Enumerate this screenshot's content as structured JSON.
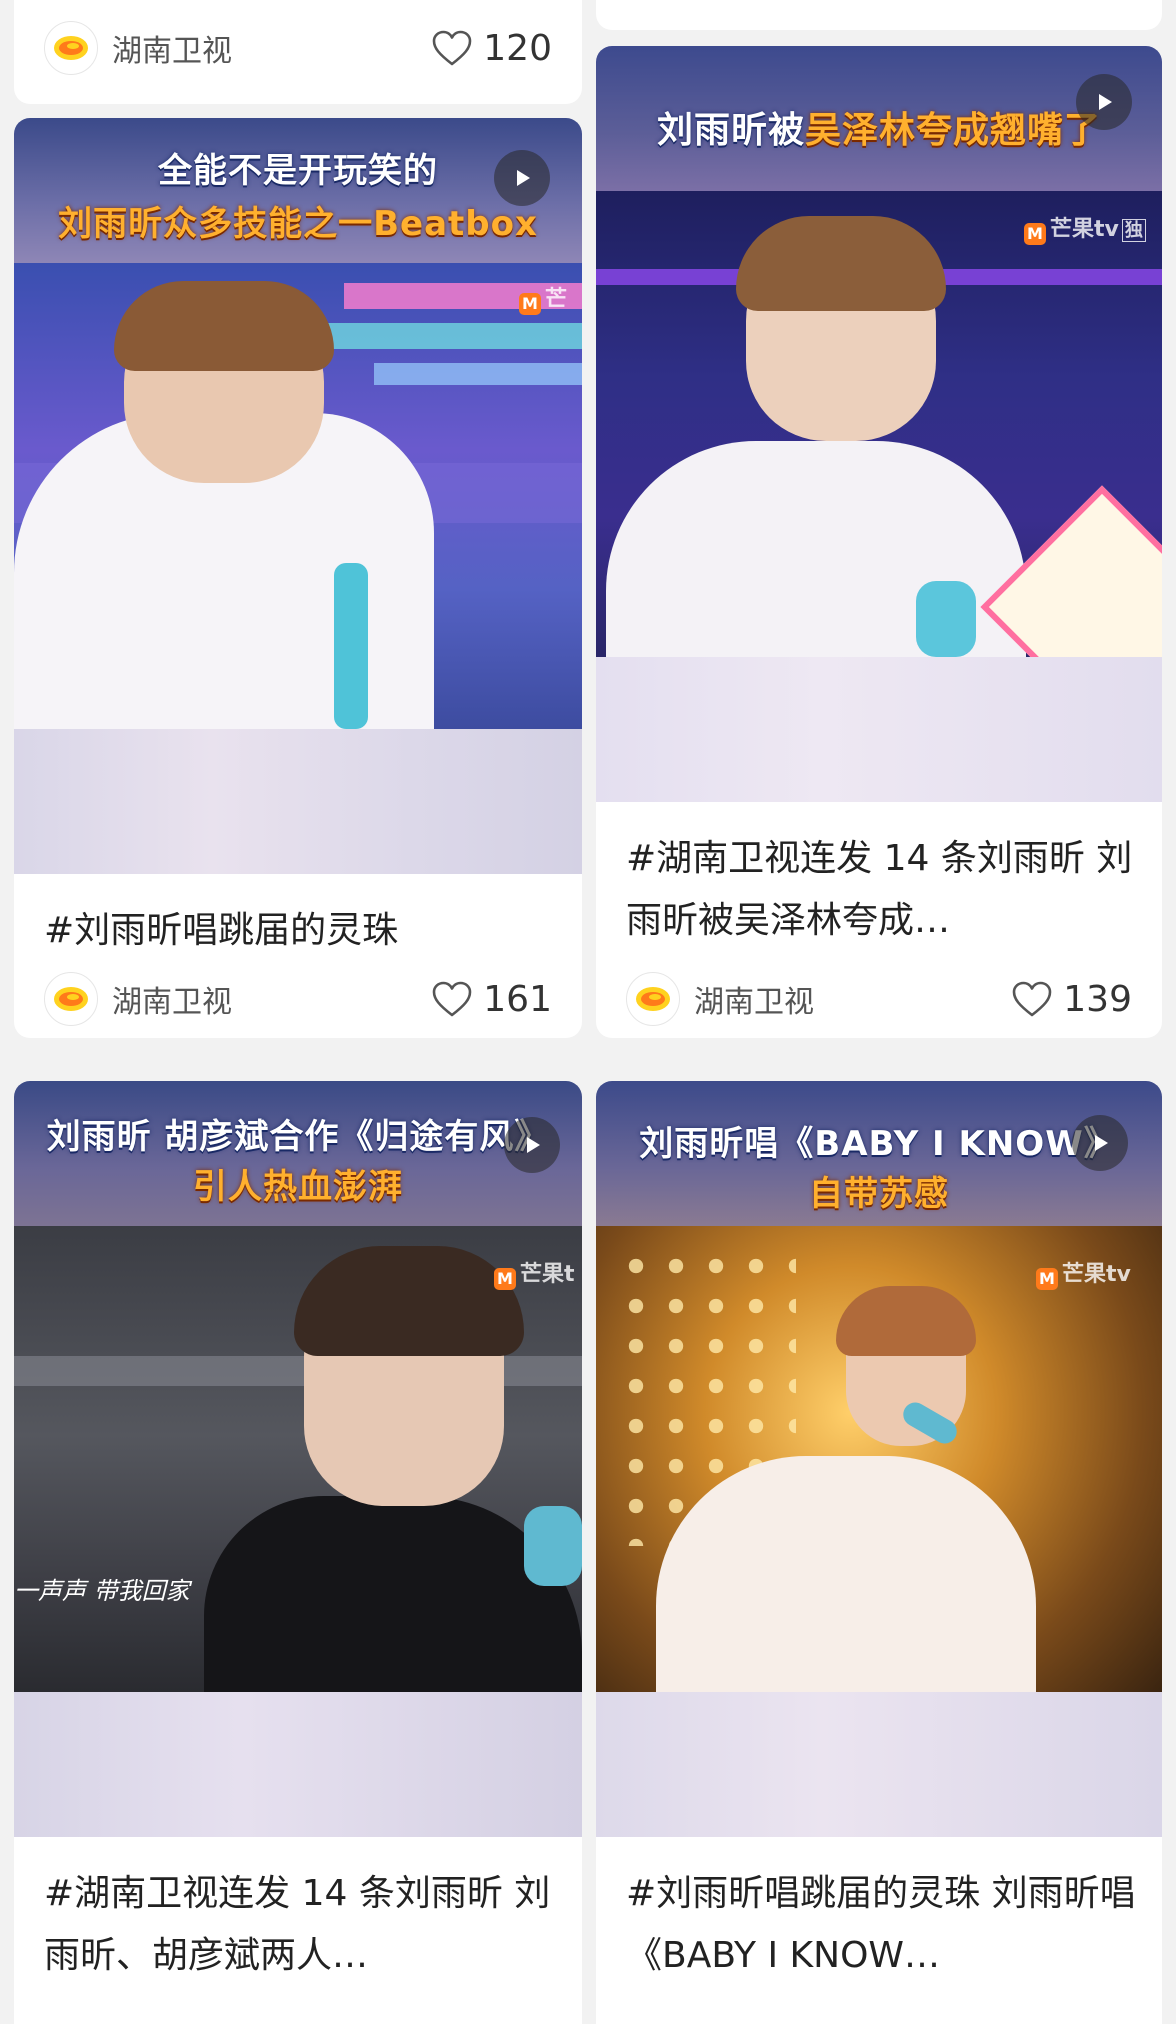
{
  "author": {
    "name": "湖南卫视",
    "avatar_icon": "hunan-tv-logo-icon"
  },
  "colors": {
    "background": "#f2f2f2",
    "card": "#ffffff",
    "overlay_orange": "#ffb02e",
    "logo_orange": "#ff7a1a",
    "logo_yellow": "#ffd21f"
  },
  "top_left_card": {
    "likes": "120"
  },
  "posts": [
    {
      "overlay_line1": "全能不是开玩笑的",
      "overlay_line2": "刘雨昕众多技能之一Beatbox",
      "watermark": "芒",
      "title": "#刘雨昕唱跳届的灵珠",
      "likes": "161"
    },
    {
      "overlay_line1": "刘雨昕被",
      "overlay_line1b": "吴泽林夸成翘嘴了",
      "watermark": "芒果tv",
      "watermark_tag": "独",
      "title": "#湖南卫视连发 14 条刘雨昕 刘雨昕被吴泽林夸成…",
      "likes": "139"
    },
    {
      "overlay_line1": "刘雨昕 胡彦斌合作《归途有风》",
      "overlay_line2": "引人热血澎湃",
      "watermark": "芒果t",
      "lyric": "一声声 带我回家",
      "title": "#湖南卫视连发 14 条刘雨昕 刘雨昕、胡彦斌两人…",
      "likes": ""
    },
    {
      "overlay_line1": "刘雨昕唱《BABY I KNOW》",
      "overlay_line2": "自带苏感",
      "watermark": "芒果tv",
      "title": "#刘雨昕唱跳届的灵珠 刘雨昕唱《BABY I KNOW…",
      "likes": ""
    }
  ]
}
